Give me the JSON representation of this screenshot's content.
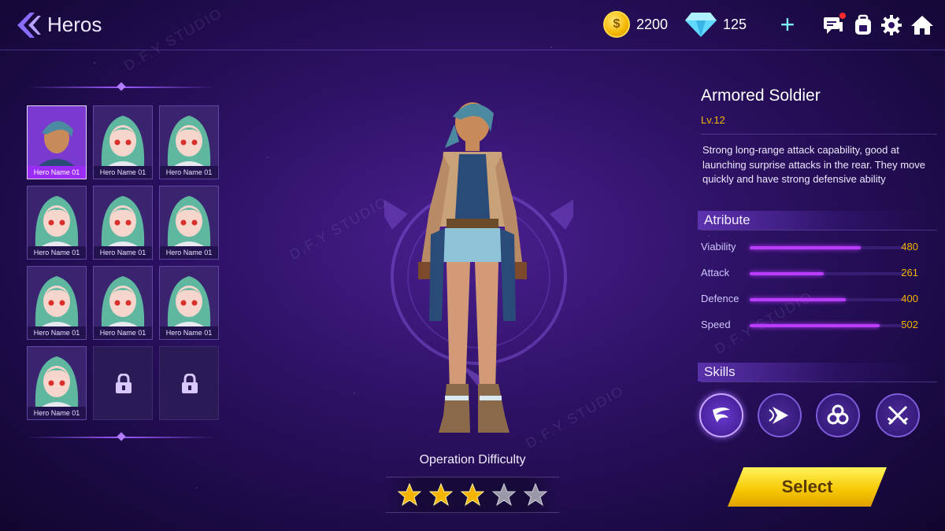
{
  "header": {
    "title": "Heros",
    "coins": "2200",
    "gems": "125"
  },
  "heroes": [
    {
      "name": "Hero Name 01",
      "selected": true,
      "locked": false,
      "portrait": "warrior"
    },
    {
      "name": "Hero Name 01",
      "selected": false,
      "locked": false,
      "portrait": "anime-girl"
    },
    {
      "name": "Hero Name 01",
      "selected": false,
      "locked": false,
      "portrait": "anime-girl"
    },
    {
      "name": "Hero Name 01",
      "selected": false,
      "locked": false,
      "portrait": "anime-girl"
    },
    {
      "name": "Hero Name 01",
      "selected": false,
      "locked": false,
      "portrait": "anime-girl"
    },
    {
      "name": "Hero Name 01",
      "selected": false,
      "locked": false,
      "portrait": "anime-girl"
    },
    {
      "name": "Hero Name 01",
      "selected": false,
      "locked": false,
      "portrait": "anime-girl"
    },
    {
      "name": "Hero Name 01",
      "selected": false,
      "locked": false,
      "portrait": "anime-girl"
    },
    {
      "name": "Hero Name 01",
      "selected": false,
      "locked": false,
      "portrait": "anime-girl"
    },
    {
      "name": "Hero Name 01",
      "selected": false,
      "locked": false,
      "portrait": "anime-girl"
    },
    {
      "name": "",
      "selected": false,
      "locked": true,
      "portrait": "lock-icon"
    },
    {
      "name": "",
      "selected": false,
      "locked": true,
      "portrait": "lock-icon"
    }
  ],
  "center": {
    "difficulty_label": "Operation Difficulty",
    "difficulty_stars": 3,
    "difficulty_max": 5
  },
  "details": {
    "name": "Armored Soldier",
    "level": "Lv.12",
    "description": "Strong long-range attack capability, good at launching surprise attacks in the rear. They move quickly and have strong defensive ability",
    "attribute_heading": "Atribute",
    "skills_heading": "Skills",
    "stats": [
      {
        "label": "Viability",
        "value": "480",
        "fill": 0.72
      },
      {
        "label": "Attack",
        "value": "261",
        "fill": 0.48
      },
      {
        "label": "Defence",
        "value": "400",
        "fill": 0.62
      },
      {
        "label": "Speed",
        "value": "502",
        "fill": 0.84
      }
    ],
    "skills": [
      "whirlwind-icon",
      "claw-slash-icon",
      "biohazard-icon",
      "crossed-swords-icon"
    ]
  },
  "actions": {
    "select_label": "Select"
  },
  "watermark": "D.F.Y STUDIO",
  "colors": {
    "accent": "#b93cff",
    "gold": "#f4b400",
    "button": "#f6c600"
  }
}
